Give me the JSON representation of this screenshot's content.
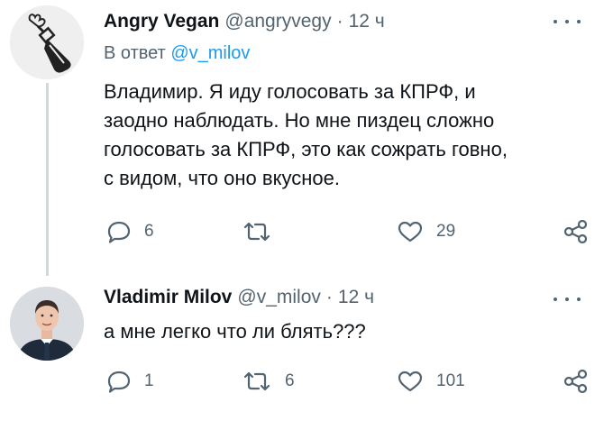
{
  "colors": {
    "accent": "#1d9bf0",
    "secondary_text": "#536471",
    "primary_text": "#0f1419",
    "thread_line": "#cfd9de"
  },
  "tweets": [
    {
      "display_name": "Angry Vegan",
      "handle": "@angryvegy",
      "separator": "·",
      "time": "12 ч",
      "reply_prefix": "В ответ",
      "reply_handle": "@v_milov",
      "lines": [
        "Владимир. Я иду голосовать за КПРФ, и",
        "заодно наблюдать. Но мне пиздец сложно",
        "голосовать за КПРФ, это как сожрать говно,",
        "с видом, что оно вкусное."
      ],
      "replies": "6",
      "retweets": "",
      "likes": "29",
      "icons": [
        "reply-icon",
        "retweet-icon",
        "like-icon",
        "share-icon",
        "more-icon"
      ]
    },
    {
      "display_name": "Vladimir Milov",
      "handle": "@v_milov",
      "separator": "·",
      "time": "12 ч",
      "lines": [
        "а мне легко что ли блять???"
      ],
      "replies": "1",
      "retweets": "6",
      "likes": "101",
      "icons": [
        "reply-icon",
        "retweet-icon",
        "like-icon",
        "share-icon",
        "more-icon"
      ]
    }
  ]
}
